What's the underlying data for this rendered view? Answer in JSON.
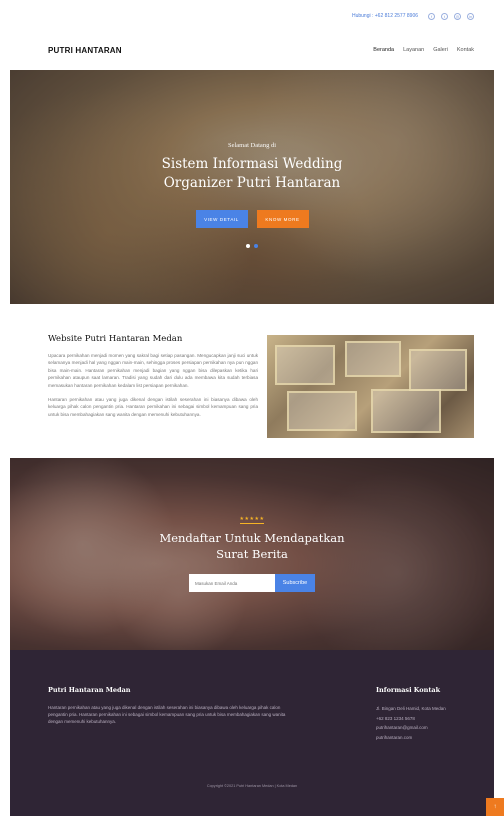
{
  "topbar": {
    "phone": "Hubungi : +62 812 2577 8906",
    "social_icons": [
      "facebook-icon",
      "twitter-icon",
      "instagram-icon",
      "linkedin-icon"
    ]
  },
  "navbar": {
    "brand": "PUTRI HANTARAN",
    "items": [
      {
        "label": "Beranda"
      },
      {
        "label": "Layanan"
      },
      {
        "label": "Galeri"
      },
      {
        "label": "Kontak"
      }
    ]
  },
  "hero": {
    "welcome": "Selamat Datang di",
    "title": "Sistem Informasi Wedding Organizer Putri Hantaran",
    "button_primary": "View Detail",
    "button_secondary": "Know More",
    "slide_count": 2,
    "active_slide": 2
  },
  "about": {
    "title": "Website Putri Hantaran Medan",
    "paragraph1": "Upacara pernikahan menjadi momen yang sakral bagi setiap pasangan. Mengucapkan janji suci untuk selamanya menjadi hal yang nggan main-main, sehingga proses persiapan pernikahan nya pun nggan bisa main-main. Hantaran pernikahan menjadi bagian yang nggan bisa dilepaskan ketika hari pernikahan ataupun saat lamaran. Tradisi yang sudah dari dulu ada membawa kita sudah terbiasa memasukan hantaran pernikahan kedalam list persiapan pernikahan.",
    "paragraph2": "Hantaran pernikahan atau yang juga dikenal dengan istilah seserahan ini biasanya dibawa oleh keluarga pihak calon pengantin pria. Hantaran pernikahan ini sebagai simbol kemampuan sang pria untuk bisa membahagiakan sang wanita dengan memenuhi kebutuhannya."
  },
  "subscribe": {
    "stars": "★★★★★",
    "title": "Mendaftar Untuk Mendapatkan Surat Berita",
    "input_placeholder": "Masukan Email Anda",
    "button": "Subscribe"
  },
  "footer": {
    "left_title": "Putri Hantaran Medan",
    "left_text": "Hantaran pernikahan atau yang juga dikenal dengan istilah seserahan ini biasanya dibawa oleh keluarga pihak calon pengantin pria. Hantaran pernikahan ini sebagai simbol kemampuan sang pria untuk bisa membahagiakan sang wanita dengan memenuhi kebutuhannya.",
    "right_title": "Informasi Kontak",
    "contacts": [
      "Jl. Bingan Deli Hamid, Kota Medan",
      "+62 823 1234 5678",
      "putrihantaran@gmail.com",
      "putrihantaran.com"
    ],
    "copyright": "Copyright ©2021 Putri Hantaran Medan | Kota Medan"
  },
  "back_to_top": "↑",
  "colors": {
    "accent_blue": "#4a83e6",
    "accent_orange": "#ee7a1f",
    "footer_bg": "#2f2535",
    "stars": "#f6b425"
  }
}
